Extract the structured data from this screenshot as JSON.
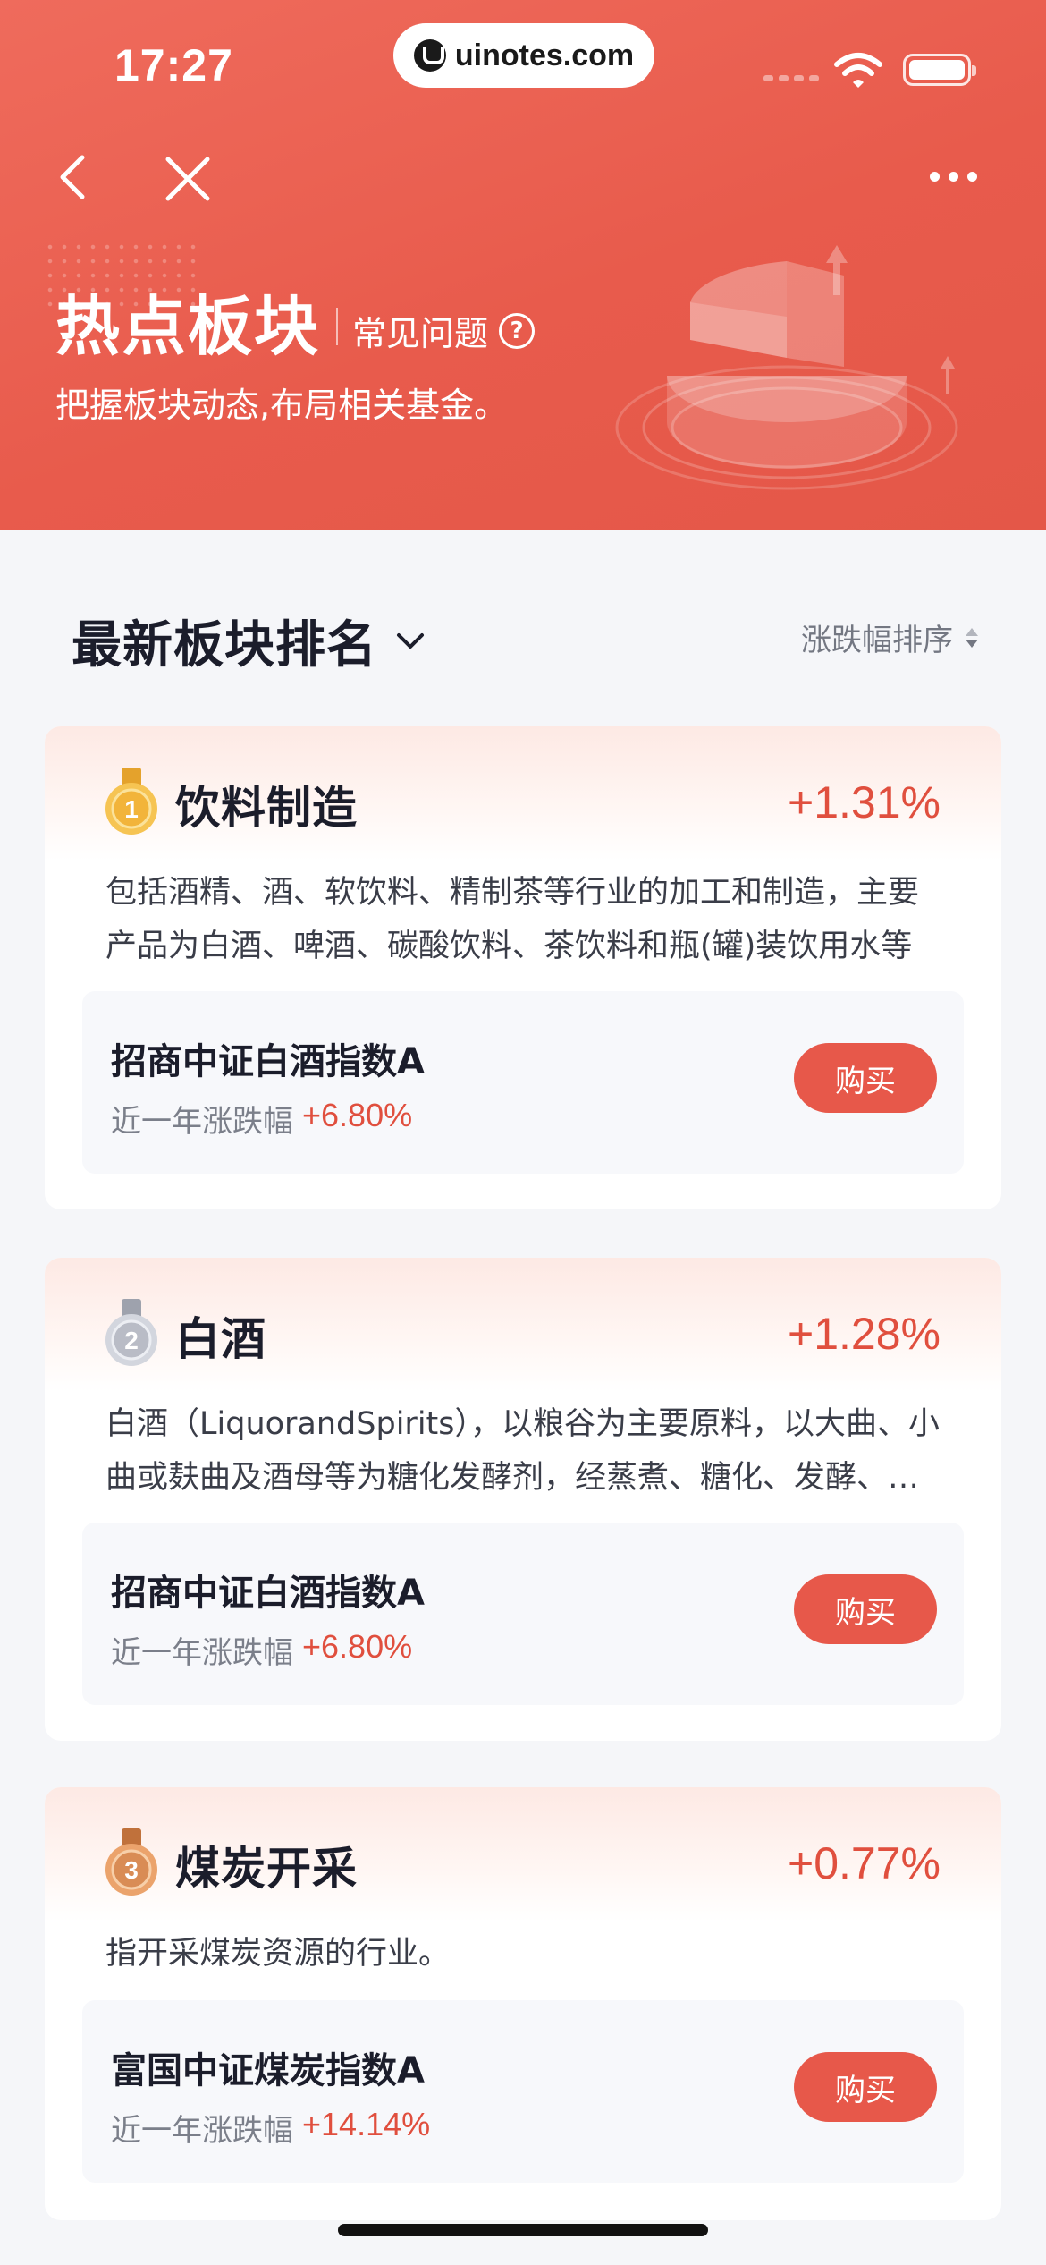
{
  "status_bar": {
    "time": "17:27",
    "url": "uinotes.com"
  },
  "header": {
    "title": "热点板块",
    "faq_label": "常见问题",
    "help_glyph": "?",
    "subtitle": "把握板块动态,布局相关基金。"
  },
  "section": {
    "title": "最新板块排名",
    "sort_label": "涨跌幅排序"
  },
  "sectors": [
    {
      "rank": "1",
      "name": "饮料制造",
      "change": "+1.31%",
      "description": "包括酒精、酒、软饮料、精制茶等行业的加工和制造，主要产品为白酒、啤酒、碳酸饮料、茶饮料和瓶(罐)装饮用水等",
      "fund_name": "招商中证白酒指数A",
      "fund_perf_label": "近一年涨跌幅",
      "fund_perf_value": "+6.80%",
      "buy_label": "购买"
    },
    {
      "rank": "2",
      "name": "白酒",
      "change": "+1.28%",
      "description": "白酒（LiquorandSpirits），以粮谷为主要原料，以大曲、小曲或麸曲及酒母等为糖化发酵剂，经蒸煮、糖化、发酵、蒸馏而制成的酒",
      "fund_name": "招商中证白酒指数A",
      "fund_perf_label": "近一年涨跌幅",
      "fund_perf_value": "+6.80%",
      "buy_label": "购买"
    },
    {
      "rank": "3",
      "name": "煤炭开采",
      "change": "+0.77%",
      "description": "指开采煤炭资源的行业。",
      "fund_name": "富国中证煤炭指数A",
      "fund_perf_label": "近一年涨跌幅",
      "fund_perf_value": "+14.14%",
      "buy_label": "购买"
    }
  ],
  "colors": {
    "header_red": "#e85b4c",
    "price_up": "#e04f3e",
    "buy_button": "#e7584a",
    "gold_medal": "#f2b43a",
    "silver_medal": "#b9bcc6",
    "bronze_medal": "#d98c55"
  },
  "icons": [
    "back-arrow-icon",
    "close-icon",
    "more-icon",
    "help-icon",
    "chevron-down-icon",
    "sort-arrows-icon",
    "medal-gold-icon",
    "medal-silver-icon",
    "medal-bronze-icon",
    "wifi-icon",
    "battery-icon"
  ]
}
